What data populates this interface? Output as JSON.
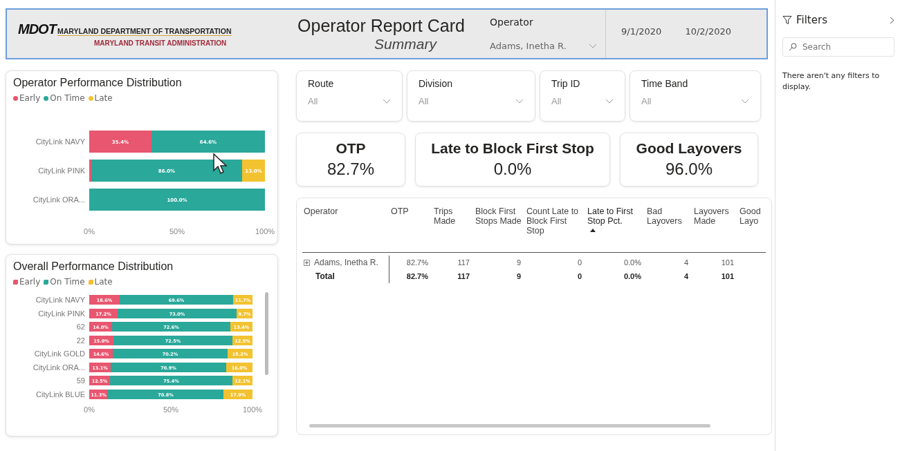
{
  "header": {
    "logo": {
      "mark": "MDOT",
      "line1": "MARYLAND DEPARTMENT OF TRANSPORTATION",
      "line2": "MARYLAND TRANSIT ADMINISTRATION"
    },
    "title": "Operator Report Card",
    "subtitle": "Summary",
    "operator": {
      "label": "Operator",
      "value": "Adams, Inetha R."
    },
    "dates": [
      "9/1/2020",
      "10/2/2020"
    ]
  },
  "operator_chart": {
    "title": "Operator Performance Distribution",
    "chart_data": {
      "type": "bar",
      "orientation": "horizontal",
      "stacked": true,
      "categories": [
        "CityLink NAVY",
        "CityLink PINK",
        "CityLink ORA..."
      ],
      "series": [
        {
          "name": "Early",
          "color": "#e8566f",
          "values": [
            35.4,
            1.0,
            null
          ],
          "value_labels": [
            "35.4%",
            null,
            null
          ]
        },
        {
          "name": "On Time",
          "color": "#2aa89a",
          "values": [
            64.6,
            86.0,
            100.0
          ],
          "value_labels": [
            "64.6%",
            "86.0%",
            "100.0%"
          ]
        },
        {
          "name": "Late",
          "color": "#f3c230",
          "values": [
            null,
            13.0,
            null
          ],
          "value_labels": [
            null,
            "13.0%",
            null
          ]
        }
      ],
      "xlim": [
        0,
        100
      ],
      "xticks": [
        {
          "value": 0,
          "label": "0%"
        },
        {
          "value": 50,
          "label": "50%"
        },
        {
          "value": 100,
          "label": "100%"
        }
      ]
    }
  },
  "overall_chart": {
    "title": "Overall Performance Distribution",
    "chart_data": {
      "type": "bar",
      "orientation": "horizontal",
      "stacked": true,
      "categories": [
        "CityLink NAVY",
        "CityLink PINK",
        "62",
        "22",
        "CityLink GOLD",
        "CityLink ORA...",
        "59",
        "CityLink BLUE"
      ],
      "series": [
        {
          "name": "Early",
          "color": "#e8566f",
          "values": [
            18.6,
            17.2,
            14.0,
            15.0,
            14.6,
            13.1,
            12.5,
            11.3
          ],
          "value_labels": [
            "18.6%",
            "17.2%",
            "14.0%",
            "15.0%",
            "14.6%",
            "13.1%",
            "12.5%",
            "11.3%"
          ]
        },
        {
          "name": "On Time",
          "color": "#2aa89a",
          "values": [
            69.6,
            73.0,
            72.6,
            72.5,
            70.2,
            70.9,
            75.4,
            70.8
          ],
          "value_labels": [
            "69.6%",
            "73.0%",
            "72.6%",
            "72.5%",
            "70.2%",
            "70.9%",
            "75.4%",
            "70.8%"
          ]
        },
        {
          "name": "Late",
          "color": "#f3c230",
          "values": [
            11.7,
            9.7,
            13.4,
            12.5,
            15.2,
            16.0,
            12.1,
            17.9
          ],
          "value_labels": [
            "11.7%",
            "9.7%",
            "13.4%",
            "12.5%",
            "15.2%",
            "16.0%",
            "12.1%",
            "17.9%"
          ]
        }
      ],
      "xlim": [
        0,
        100
      ],
      "xticks": [
        {
          "value": 0,
          "label": "0%"
        },
        {
          "value": 50,
          "label": "50%"
        },
        {
          "value": 100,
          "label": "100%"
        }
      ]
    }
  },
  "slicers": [
    {
      "label": "Route",
      "value": "All"
    },
    {
      "label": "Division",
      "value": "All"
    },
    {
      "label": "Trip ID",
      "value": "All"
    },
    {
      "label": "Time Band",
      "value": "All"
    }
  ],
  "kpis": [
    {
      "title": "OTP",
      "value": "82.7%"
    },
    {
      "title": "Late to Block First Stop",
      "value": "0.0%"
    },
    {
      "title": "Good Layovers",
      "value": "96.0%"
    }
  ],
  "table": {
    "columns": [
      {
        "label": "Operator",
        "sorted": false
      },
      {
        "label": "OTP",
        "sorted": false
      },
      {
        "label": "Trips Made",
        "sorted": false
      },
      {
        "label": "Block First Stops Made",
        "sorted": false
      },
      {
        "label": "Count Late to Block First Stop",
        "sorted": false
      },
      {
        "label": "Late to First Stop Pct.",
        "sorted": true
      },
      {
        "label": "Bad Layovers",
        "sorted": false
      },
      {
        "label": "Layovers Made",
        "sorted": false
      },
      {
        "label": "Good Layo",
        "sorted": false
      }
    ],
    "rows": [
      {
        "kind": "row",
        "cells": [
          "Adams, Inetha R.",
          "82.7%",
          "117",
          "9",
          "0",
          "0.0%",
          "4",
          "101"
        ]
      },
      {
        "kind": "total",
        "cells": [
          "Total",
          "82.7%",
          "117",
          "9",
          "0",
          "0.0%",
          "4",
          "101"
        ]
      }
    ]
  },
  "filters": {
    "title": "Filters",
    "search_placeholder": "Search",
    "message": "There aren't any filters to display."
  }
}
